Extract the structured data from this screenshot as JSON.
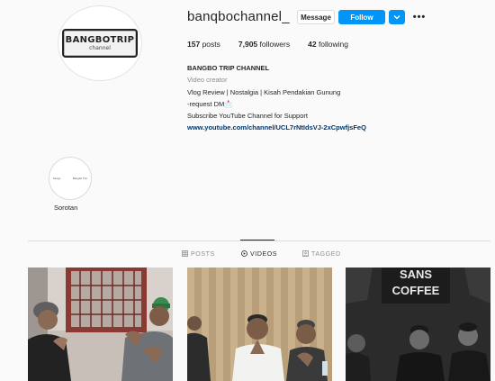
{
  "profile": {
    "avatar_logo_line1": "BANGBOTRIP",
    "avatar_logo_line2": "channel",
    "username": "banqbochannel_",
    "message_label": "Message",
    "follow_label": "Follow",
    "dropdown_icon": "chevron-down-icon",
    "more_icon": "more-options-icon",
    "more_glyph": "•••",
    "dropdown_glyph": "⌄",
    "stats": {
      "posts_count": "157",
      "posts_label": "posts",
      "followers_count": "7,905",
      "followers_label": "followers",
      "following_count": "42",
      "following_label": "following"
    },
    "bio": {
      "name": "BANGBO TRIP CHANNEL",
      "category": "Video creator",
      "line1": "Vlog Review | Nostalgia | Kisah Pendakian Gunung",
      "line2": "-request DM📩",
      "line3": "Subscribe YouTube Channel for Support",
      "link": "www.youtube.com/channel/UCL7rNtIdsVJ-2xCpwfjsFeQ"
    }
  },
  "highlights": [
    {
      "label": "Sorotan",
      "mini_text_left": "bango",
      "mini_text_right": "Bangbo Trip"
    }
  ],
  "tabs": [
    {
      "label": "POSTS",
      "icon": "grid-icon",
      "active": false
    },
    {
      "label": "VIDEOS",
      "icon": "video-icon",
      "active": true
    },
    {
      "label": "TAGGED",
      "icon": "tagged-icon",
      "active": false
    }
  ],
  "thumbnails": [
    {
      "name": "video-thumbnail-1"
    },
    {
      "name": "video-thumbnail-2"
    },
    {
      "name": "video-thumbnail-3",
      "overlay_text_line1": "SANS",
      "overlay_text_line2": "COFFEE"
    }
  ],
  "colors": {
    "accent": "#0095f6",
    "link": "#00376b",
    "muted": "#8e8e8e",
    "background": "#fafafa"
  }
}
